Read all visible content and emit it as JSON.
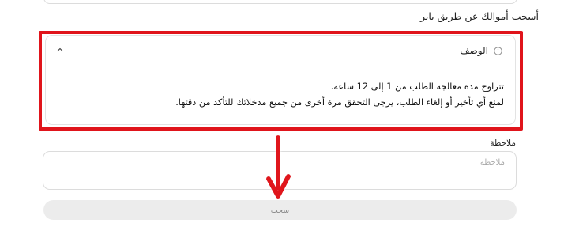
{
  "page": {
    "title": "أسحب أموالك عن طريق باير"
  },
  "description": {
    "title": "الوصف",
    "lines": [
      "تتراوح مدة معالجة الطلب من 1 إلى 12 ساعة.",
      "لمنع أي تأخير أو إلغاء الطلب، يرجى التحقق مرة أخرى من جميع مدخلاتك للتأكد من دقتها."
    ],
    "icon": "info-icon",
    "toggle_icon": "chevron-up-icon"
  },
  "note": {
    "label": "ملاحظة",
    "placeholder": "ملاحظة",
    "value": ""
  },
  "submit": {
    "label": "سحب"
  },
  "annotation": {
    "highlight_color": "#e0141b",
    "arrow_color": "#e0141b"
  }
}
